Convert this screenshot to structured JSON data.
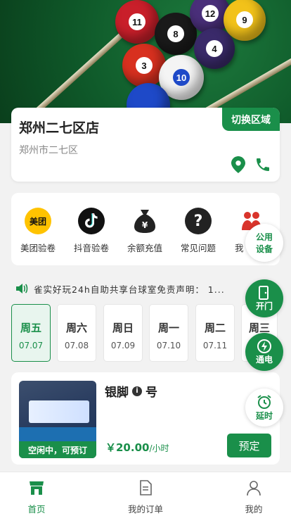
{
  "store": {
    "name": "郑州二七区店",
    "address": "郑州市二七区",
    "switch_label": "切换区域"
  },
  "menu": [
    {
      "label": "美团验卷",
      "icon": "meituan-icon",
      "icon_text": "美团"
    },
    {
      "label": "抖音验卷",
      "icon": "douyin-icon"
    },
    {
      "label": "余额充值",
      "icon": "money-bag-icon",
      "icon_text": "¥"
    },
    {
      "label": "常见问题",
      "icon": "question-icon",
      "icon_text": "?"
    },
    {
      "label": "我",
      "icon": "people-icon"
    }
  ],
  "notice": "雀实好玩24h自助共享台球室免责声明： 1...",
  "days": [
    {
      "weekday": "周五",
      "date": "07.07",
      "active": true
    },
    {
      "weekday": "周六",
      "date": "07.08"
    },
    {
      "weekday": "周日",
      "date": "07.09"
    },
    {
      "weekday": "周一",
      "date": "07.10"
    },
    {
      "weekday": "周二",
      "date": "07.11"
    },
    {
      "weekday": "周三",
      "date": ""
    }
  ],
  "table": {
    "name_prefix": "银脚",
    "name_suffix": "号",
    "info_icon": "i",
    "status": "空闲中，可预订",
    "price": "￥20.00",
    "price_unit": "/小时",
    "book_label": "预定"
  },
  "fabs": {
    "public_device": [
      "公用",
      "设备"
    ],
    "open_door": "开门",
    "power": "通电",
    "extend": "延时"
  },
  "tabbar": [
    {
      "label": "首页",
      "active": true
    },
    {
      "label": "我的订单"
    },
    {
      "label": "我的"
    }
  ],
  "colors": {
    "primary": "#1a8f4a",
    "meituan": "#ffc300"
  }
}
